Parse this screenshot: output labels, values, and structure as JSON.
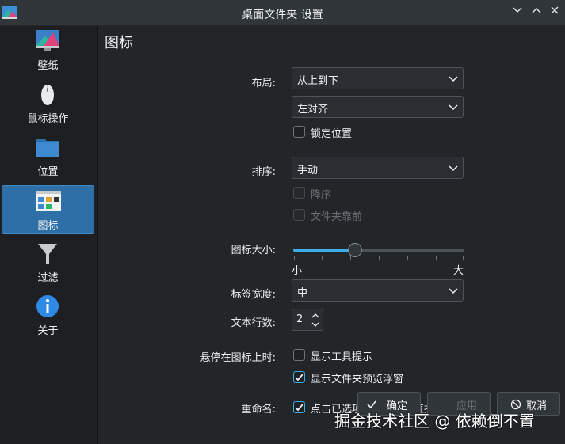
{
  "window": {
    "title": "桌面文件夹 设置",
    "controls": [
      "chevron-down",
      "chevron-up",
      "close"
    ]
  },
  "sidebar": {
    "items": [
      {
        "label": "壁纸",
        "icon": "monitor-wallpaper-icon"
      },
      {
        "label": "鼠标操作",
        "icon": "mouse-icon"
      },
      {
        "label": "位置",
        "icon": "folder-icon"
      },
      {
        "label": "图标",
        "icon": "icons-icon",
        "active": true
      },
      {
        "label": "过滤",
        "icon": "funnel-icon"
      },
      {
        "label": "关于",
        "icon": "info-icon"
      }
    ]
  },
  "page": {
    "title": "图标",
    "layout_label": "布局:",
    "layout_value": "从上到下",
    "align_value": "左对齐",
    "lock_label": "锁定位置",
    "lock_checked": false,
    "sort_label": "排序:",
    "sort_value": "手动",
    "descending_label": "降序",
    "folders_first_label": "文件夹靠前",
    "icon_size_label": "图标大小:",
    "icon_size_min": "小",
    "icon_size_max": "大",
    "icon_size_level": 0.35,
    "label_width_label": "标签宽度:",
    "label_width_value": "中",
    "text_lines_label": "文本行数:",
    "text_lines_value": "2",
    "hover_label": "悬停在图标上时:",
    "tooltip_label": "显示工具提示",
    "tooltip_checked": false,
    "preview_label": "显示文件夹预览浮窗",
    "preview_checked": true,
    "rename_label": "重命名:",
    "rename_text": "点击已选项目的文字以直接重命名",
    "rename_checked": true
  },
  "buttons": {
    "ok": "确定",
    "apply": "应用",
    "cancel": "取消"
  },
  "watermark": "掘金技术社区 @ 依赖倒不置",
  "colors": {
    "accent": "#3daee9",
    "active_item": "#2d6fa6",
    "annotation_arrow": "#f5e400"
  }
}
